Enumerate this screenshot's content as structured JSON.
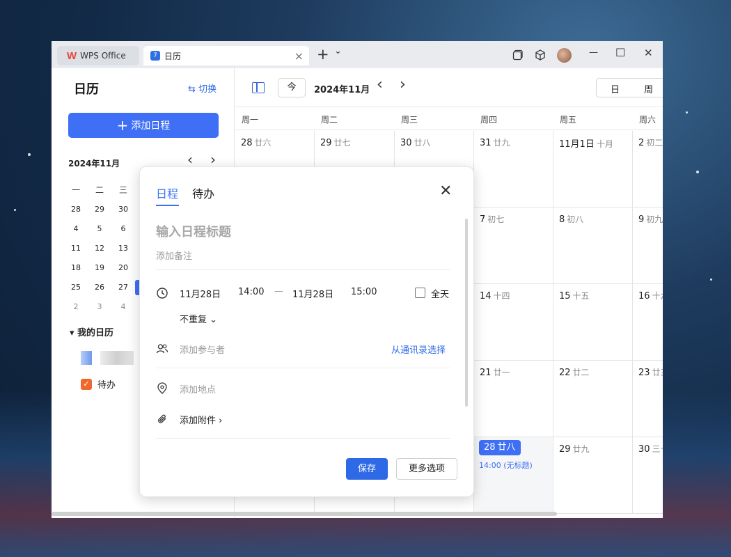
{
  "titlebar": {
    "wps_tab_label": "WPS Office",
    "calendar_tab_label": "日历",
    "calendar_tab_icon_text": "7",
    "close_tab_symbol": "×",
    "new_tab_symbol": "+",
    "new_tab_menu_symbol": "⌄",
    "minimize_symbol": "—",
    "maximize_symbol": "☐",
    "close_symbol": "✕"
  },
  "sidebar": {
    "title": "日历",
    "switch_label": "⇆ 切换",
    "add_button_label": "添加日程",
    "add_button_plus": "+",
    "mini_month_label": "2024年11月",
    "mini_prev": "‹",
    "mini_next": "›",
    "mini_weekdays": [
      "一",
      "二",
      "三"
    ],
    "mini_weeks": [
      [
        "28",
        "29",
        "30"
      ],
      [
        "4",
        "5",
        "6"
      ],
      [
        "11",
        "12",
        "13"
      ],
      [
        "18",
        "19",
        "20"
      ],
      [
        "25",
        "26",
        "27"
      ],
      [
        "2",
        "3",
        "4"
      ]
    ],
    "my_calendars_label": "▾ 我的日历",
    "todo_label": "待办",
    "todo_check": "✓"
  },
  "toolbar": {
    "today_label": "今",
    "month_label": "2024年11月",
    "prev_symbol": "‹",
    "next_symbol": "›",
    "view_day": "日",
    "view_week": "周"
  },
  "week_headers": [
    "周一",
    "周二",
    "周三",
    "周四",
    "周五",
    "周六"
  ],
  "calendar_rows": [
    [
      {
        "day": "28",
        "lunar": "廿六"
      },
      {
        "day": "29",
        "lunar": "廿七"
      },
      {
        "day": "30",
        "lunar": "廿八"
      },
      {
        "day": "31",
        "lunar": "廿九"
      },
      {
        "day": "11月1日",
        "lunar": "十月"
      },
      {
        "day": "2",
        "lunar": "初二"
      }
    ],
    [
      {
        "day": "",
        "lunar": ""
      },
      {
        "day": "",
        "lunar": ""
      },
      {
        "day": "",
        "lunar": ""
      },
      {
        "day": "7",
        "lunar": "初七"
      },
      {
        "day": "8",
        "lunar": "初八"
      },
      {
        "day": "9",
        "lunar": "初九"
      }
    ],
    [
      {
        "day": "",
        "lunar": ""
      },
      {
        "day": "",
        "lunar": ""
      },
      {
        "day": "",
        "lunar": ""
      },
      {
        "day": "14",
        "lunar": "十四"
      },
      {
        "day": "15",
        "lunar": "十五"
      },
      {
        "day": "16",
        "lunar": "十六"
      }
    ],
    [
      {
        "day": "",
        "lunar": ""
      },
      {
        "day": "",
        "lunar": ""
      },
      {
        "day": "",
        "lunar": ""
      },
      {
        "day": "21",
        "lunar": "廿一"
      },
      {
        "day": "22",
        "lunar": "廿二"
      },
      {
        "day": "23",
        "lunar": "廿三"
      }
    ],
    [
      {
        "day": "",
        "lunar": ""
      },
      {
        "day": "",
        "lunar": ""
      },
      {
        "day": "",
        "lunar": ""
      },
      {
        "day": "28",
        "lunar": "廿八"
      },
      {
        "day": "29",
        "lunar": "廿九"
      },
      {
        "day": "30",
        "lunar": "三十"
      }
    ]
  ],
  "today_event": "14:00 (无标题)",
  "dialog": {
    "tab_schedule": "日程",
    "tab_todo": "待办",
    "close_symbol": "✕",
    "title_placeholder": "输入日程标题",
    "note_placeholder": "添加备注",
    "start_date": "11月28日",
    "start_time": "14:00",
    "dash": "—",
    "end_date": "11月28日",
    "end_time": "15:00",
    "all_day_label": "全天",
    "repeat_label": "不重复 ⌄",
    "participants_placeholder": "添加参与者",
    "contacts_link": "从通讯录选择",
    "location_placeholder": "添加地点",
    "attachment_label": "添加附件 ›",
    "save_label": "保存",
    "more_label": "更多选项"
  },
  "colors": {
    "accent": "#3e6ff5",
    "todo_orange": "#f0682d"
  }
}
